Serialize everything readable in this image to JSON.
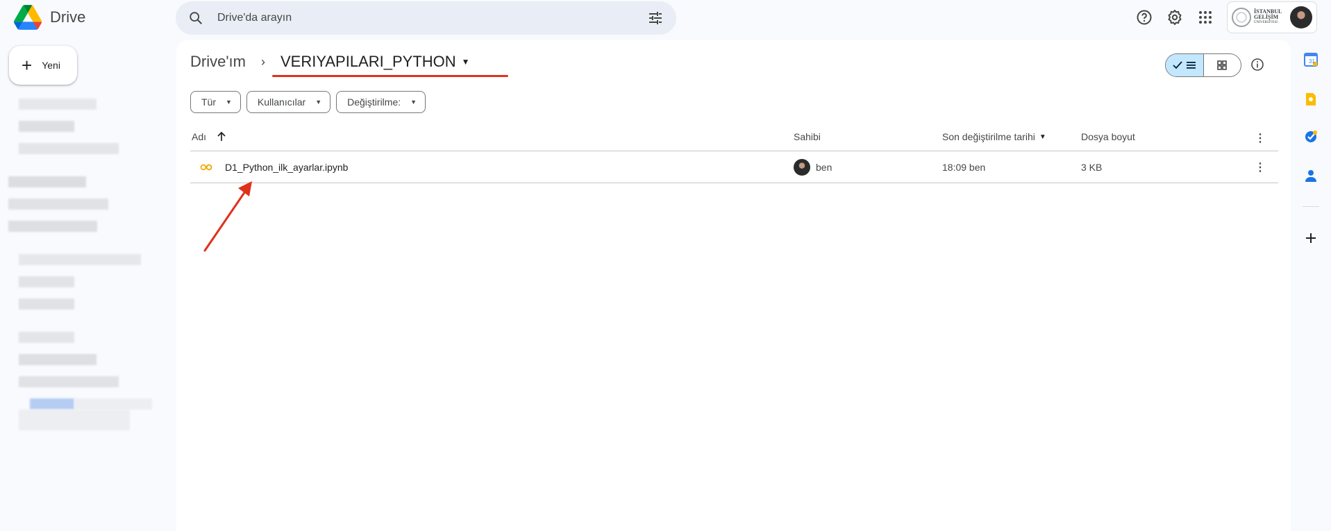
{
  "app": {
    "name": "Drive"
  },
  "search": {
    "placeholder": "Drive'da arayın"
  },
  "account": {
    "org_line1": "İSTANBUL",
    "org_line2": "GELİŞİM",
    "org_line3": "ÜNİVERSİTESİ"
  },
  "sidebar": {
    "new_label": "Yeni"
  },
  "breadcrumb": {
    "root": "Drive'ım",
    "current": "VERIYAPILARI_PYTHON"
  },
  "filters": [
    {
      "label": "Tür"
    },
    {
      "label": "Kullanıcılar"
    },
    {
      "label": "Değiştirilme:"
    }
  ],
  "table": {
    "columns": {
      "name": "Adı",
      "owner": "Sahibi",
      "modified": "Son değiştirilme tarihi",
      "size": "Dosya boyut"
    },
    "rows": [
      {
        "name": "D1_Python_ilk_ayarlar.ipynb",
        "owner": "ben",
        "modified": "18:09 ben",
        "size": "3 KB"
      }
    ]
  },
  "colors": {
    "accent": "#0b57d0",
    "annotation": "#e0311b",
    "selected_view": "#c2e7ff"
  },
  "icons": [
    "drive-logo-icon",
    "search-icon",
    "tune-icon",
    "help-icon",
    "settings-icon",
    "apps-grid-icon",
    "plus-icon",
    "chevron-right-icon",
    "caret-down-icon",
    "check-icon",
    "list-icon",
    "grid-icon",
    "info-icon",
    "arrow-up-icon",
    "colab-icon",
    "more-vert-icon",
    "calendar-icon",
    "keep-icon",
    "tasks-icon",
    "contacts-icon"
  ]
}
